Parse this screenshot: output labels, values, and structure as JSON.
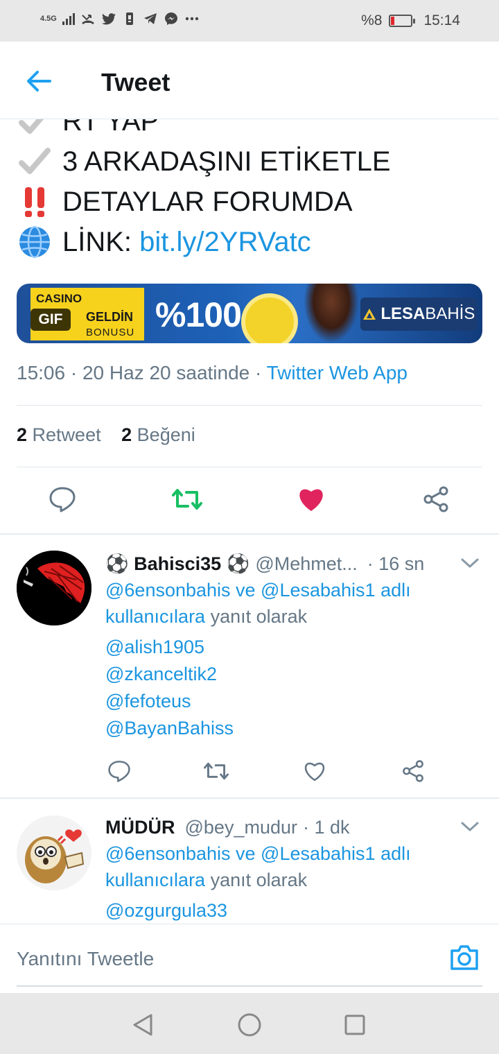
{
  "status_bar": {
    "network": "4.5G",
    "battery_text": "%8",
    "time": "15:14",
    "icons": [
      "signal-icon",
      "missed-call-icon",
      "twitter-icon",
      "sim-icon",
      "telegram-icon",
      "messenger-icon",
      "more-icon"
    ]
  },
  "header": {
    "title": "Tweet",
    "back_icon": "back-arrow-icon"
  },
  "tweet": {
    "lines": [
      {
        "emoji": "check-mark-icon",
        "text": "RT YAP"
      },
      {
        "emoji": "check-mark-icon",
        "text": "3 ARKADAŞINI ETİKETLE"
      },
      {
        "emoji": "double-exclamation-icon",
        "text": "DETAYLAR FORUMDA"
      },
      {
        "emoji": "globe-icon",
        "text": "LİNK: ",
        "link": "bit.ly/2YRVatc"
      }
    ],
    "media": {
      "gif_badge": "GIF",
      "casino": "CASINO",
      "geldin": "GELDİN",
      "bonus": "BONUSU",
      "percent": "%100",
      "brand_bold": "LESA",
      "brand_light": "BAHİS"
    },
    "meta_time": "15:06 · 20 Haz 20 saatinde · ",
    "meta_source": "Twitter Web App",
    "retweet_count": "2",
    "retweet_label": "Retweet",
    "like_count": "2",
    "like_label": "Beğeni",
    "colors": {
      "retweet": "#17bf63",
      "like": "#e0245e",
      "link": "#1b95e0",
      "muted": "#657786"
    }
  },
  "replies": [
    {
      "name": "⚽ Bahisci35 ⚽",
      "handle": "@Mehmet...",
      "time": "· 16 sn",
      "reply_to_links": "@6ensonbahis ve @Lesabahis1 adlı kullanıcılara",
      "reply_to_suffix": " yanıt olarak",
      "mentions": [
        "@alish1905",
        "@zkanceltik2",
        "@fefoteus",
        "@BayanBahiss"
      ]
    },
    {
      "name": "MÜDÜR",
      "handle": "@bey_mudur",
      "time": "· 1 dk",
      "reply_to_links": "@6ensonbahis ve @Lesabahis1 adlı kullanıcılara",
      "reply_to_suffix": " yanıt olarak",
      "mentions": [
        "@ozgurgula33"
      ]
    }
  ],
  "compose": {
    "placeholder": "Yanıtını Tweetle"
  }
}
